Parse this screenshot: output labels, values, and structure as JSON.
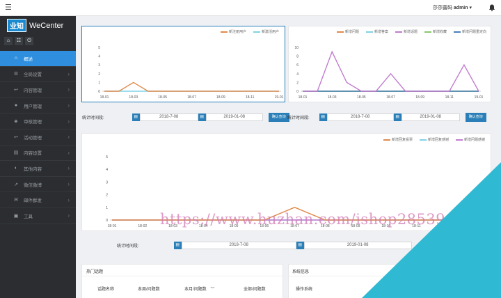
{
  "header": {
    "user_label": "莎莎露码",
    "username": "admin",
    "caret": "▾"
  },
  "brand": {
    "logo_text": "业知",
    "name": "WeCenter"
  },
  "sidebar": {
    "items": [
      {
        "label": "概述",
        "icon": "home-icon",
        "active": true
      },
      {
        "label": "全局设置",
        "icon": "gear-icon"
      },
      {
        "label": "内容管理",
        "icon": "reply-icon"
      },
      {
        "label": "用户管理",
        "icon": "user-icon"
      },
      {
        "label": "审核管理",
        "icon": "shield-icon"
      },
      {
        "label": "活动管理",
        "icon": "reply-icon"
      },
      {
        "label": "内容设置",
        "icon": "doc-icon"
      },
      {
        "label": "其他内容",
        "icon": "pie-icon"
      },
      {
        "label": "微信微博",
        "icon": "share-icon"
      },
      {
        "label": "邮件群发",
        "icon": "mail-icon"
      },
      {
        "label": "工具",
        "icon": "briefcase-icon"
      }
    ]
  },
  "charts": {
    "chart1": {
      "type": "line",
      "categories": [
        "18-01",
        "18-02",
        "18-03",
        "18-04",
        "18-05",
        "18-06",
        "18-07",
        "18-08",
        "18-09",
        "18-10",
        "18-11",
        "18-12",
        "19-01"
      ],
      "tick_labels": [
        "18-01",
        "18-03",
        "18-05",
        "18-07",
        "18-09",
        "18-11",
        "19-01"
      ],
      "ylim": [
        0,
        5
      ],
      "yticks": [
        "0",
        "1",
        "2",
        "3",
        "4",
        "5"
      ],
      "series": [
        {
          "name": "新注册用户",
          "color": "#e08a4c",
          "values": [
            0,
            0,
            1,
            0,
            0,
            0,
            0,
            0,
            0,
            0,
            0,
            0,
            0
          ]
        },
        {
          "name": "新激活用户",
          "color": "#7fd3e6",
          "values": [
            0,
            0,
            0,
            0,
            0,
            0,
            0,
            0,
            0,
            0,
            0,
            0,
            0
          ]
        }
      ]
    },
    "chart2": {
      "type": "line",
      "categories": [
        "18-01",
        "18-02",
        "18-03",
        "18-04",
        "18-05",
        "18-06",
        "18-07",
        "18-08",
        "18-09",
        "18-10",
        "18-11",
        "18-12",
        "19-01"
      ],
      "tick_labels": [
        "18-01",
        "18-03",
        "18-05",
        "18-07",
        "18-09",
        "18-11",
        "19-01"
      ],
      "ylim": [
        0,
        10
      ],
      "yticks": [
        "0",
        "2",
        "4",
        "6",
        "8",
        "10"
      ],
      "series": [
        {
          "name": "新增问题",
          "color": "#e08a4c",
          "values": [
            0,
            0,
            0,
            0,
            0,
            0,
            0,
            0,
            0,
            0,
            0,
            0,
            0
          ]
        },
        {
          "name": "新增答案",
          "color": "#7fd3e6",
          "values": [
            0,
            0,
            0,
            0,
            0,
            0,
            0,
            0,
            0,
            0,
            0,
            0,
            0
          ]
        },
        {
          "name": "新增话题",
          "color": "#c27bd0",
          "values": [
            0,
            0,
            9,
            2,
            0,
            0,
            4,
            0,
            0,
            0,
            0,
            6,
            0
          ]
        },
        {
          "name": "新增收藏",
          "color": "#8ac66a",
          "values": [
            0,
            0,
            0,
            0,
            0,
            0,
            0,
            0,
            0,
            0,
            0,
            0,
            0
          ]
        },
        {
          "name": "新增问题重定向",
          "color": "#4a7fb8",
          "values": [
            0,
            0,
            0,
            0,
            0,
            0,
            0,
            0,
            0,
            0,
            0,
            0,
            0
          ]
        }
      ]
    },
    "chart3": {
      "type": "line",
      "categories": [
        "18-01",
        "18-02",
        "18-03",
        "18-04",
        "18-05",
        "18-06",
        "18-07",
        "18-08",
        "18-09",
        "18-10",
        "18-11",
        "18-12",
        "19-01"
      ],
      "tick_labels": [
        "18-01",
        "18-02",
        "18-03",
        "18-04",
        "18-05",
        "18-06",
        "18-07",
        "18-08",
        "18-09",
        "18-10",
        "18-11",
        "18-12",
        "19-01"
      ],
      "ylim": [
        0,
        5
      ],
      "yticks": [
        "0",
        "1",
        "2",
        "3",
        "4",
        "5"
      ],
      "series": [
        {
          "name": "新增回复投票",
          "color": "#e08a4c",
          "values": [
            0,
            0,
            0,
            0,
            0,
            0,
            1,
            0,
            0,
            0,
            0,
            0,
            0
          ]
        },
        {
          "name": "新增回复感谢",
          "color": "#7fd3e6",
          "values": [
            0,
            0,
            0,
            0,
            0,
            0,
            0,
            0,
            0,
            0,
            0,
            0,
            0
          ]
        },
        {
          "name": "新增问题感谢",
          "color": "#c27bd0",
          "values": [
            0,
            0,
            0,
            0,
            0,
            0,
            0,
            0,
            0,
            0,
            0,
            0,
            0
          ]
        }
      ]
    }
  },
  "date_filters": {
    "label": "统计时间段:",
    "start": "2018-7-08",
    "end": "2019-01-08",
    "query_button": "确认查询",
    "cal_icon": "▤"
  },
  "hot_topics": {
    "title": "热门话题",
    "columns": [
      "话题名称",
      "本周/问题数",
      "本月/问题数",
      "全部/问题数"
    ],
    "sort_icon": "﹀"
  },
  "system_info": {
    "title": "系统信息",
    "row_label": "操作系统"
  },
  "watermark": "https://www.huzhan.com/ishop28539",
  "icons": {
    "menu": "☰",
    "chevron": "›",
    "home": "⌂",
    "list": "☷",
    "power": "⏻"
  }
}
